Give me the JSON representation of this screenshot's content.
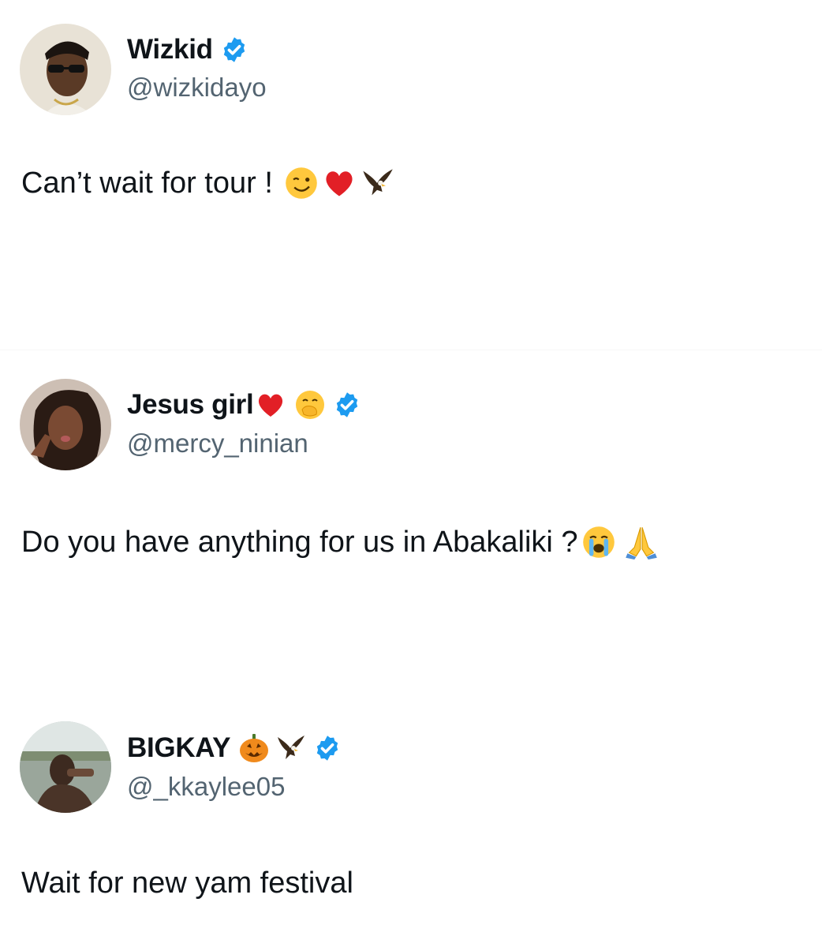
{
  "tweets": [
    {
      "name": "Wizkid",
      "name_emojis": [],
      "verified": true,
      "handle": "@wizkidayo",
      "text": "Can’t wait for tour !",
      "text_emojis": [
        "winking-face-emoji",
        "red-heart-emoji",
        "eagle-emoji"
      ]
    },
    {
      "name": "Jesus girl",
      "name_emojis": [
        "red-heart-emoji",
        "face-with-hand-over-mouth-emoji"
      ],
      "verified": true,
      "handle": "@mercy_ninian",
      "text": "Do you have anything for us in Abakaliki ?",
      "text_emojis": [
        "loudly-crying-face-emoji",
        "folded-hands-emoji"
      ]
    },
    {
      "name": "BIGKAY",
      "name_emojis": [
        "jack-o-lantern-emoji",
        "eagle-emoji"
      ],
      "verified": true,
      "handle": "@_kkaylee05",
      "text": "Wait for new yam festival",
      "text_emojis": []
    }
  ],
  "colors": {
    "text": "#0f1419",
    "handle": "#536471",
    "verified": "#1d9bf0",
    "background": "#ffffff"
  }
}
